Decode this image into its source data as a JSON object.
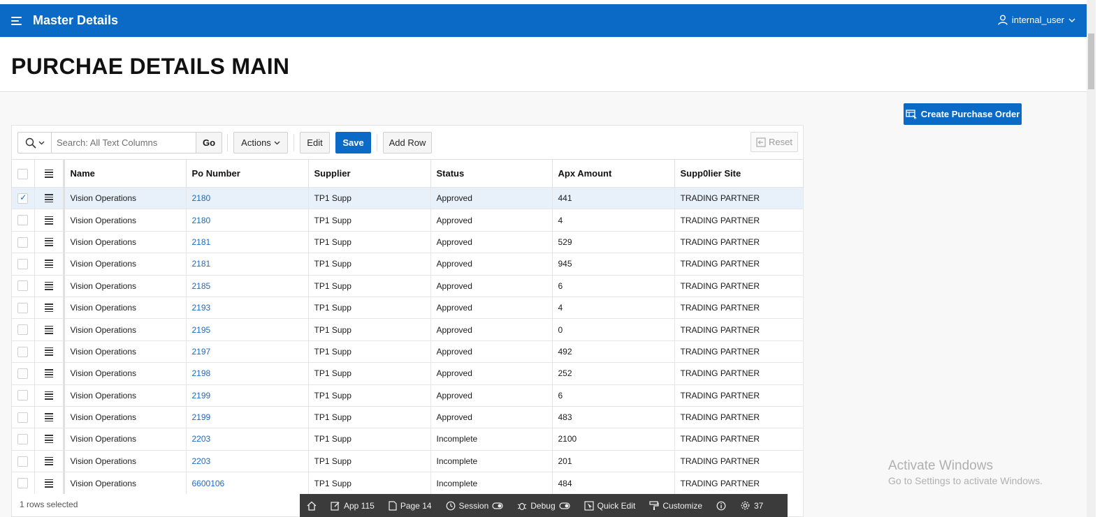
{
  "header": {
    "menu_icon": "hamburger-icon",
    "app_title": "Master Details",
    "user_name": "internal_user",
    "user_icon": "user-icon",
    "brand_color": "#0b6ac6"
  },
  "page": {
    "title": "PURCHAE DETAILS MAIN"
  },
  "actions": {
    "create_label": "Create Purchase Order"
  },
  "toolbar": {
    "search_placeholder": "Search: All Text Columns",
    "search_value": "",
    "go_label": "Go",
    "actions_label": "Actions",
    "edit_label": "Edit",
    "save_label": "Save",
    "add_row_label": "Add Row",
    "reset_label": "Reset"
  },
  "grid": {
    "columns": [
      "Name",
      "Po Number",
      "Supplier",
      "Status",
      "Apx Amount",
      "Supp0lier Site"
    ],
    "rows": [
      {
        "name": "Vision Operations",
        "po": "2180",
        "supplier": "TP1 Supp",
        "status": "Approved",
        "amount": "441",
        "site": "TRADING PARTNER",
        "selected": true
      },
      {
        "name": "Vision Operations",
        "po": "2180",
        "supplier": "TP1 Supp",
        "status": "Approved",
        "amount": "4",
        "site": "TRADING PARTNER",
        "selected": false
      },
      {
        "name": "Vision Operations",
        "po": "2181",
        "supplier": "TP1 Supp",
        "status": "Approved",
        "amount": "529",
        "site": "TRADING PARTNER",
        "selected": false
      },
      {
        "name": "Vision Operations",
        "po": "2181",
        "supplier": "TP1 Supp",
        "status": "Approved",
        "amount": "945",
        "site": "TRADING PARTNER",
        "selected": false
      },
      {
        "name": "Vision Operations",
        "po": "2185",
        "supplier": "TP1 Supp",
        "status": "Approved",
        "amount": "6",
        "site": "TRADING PARTNER",
        "selected": false
      },
      {
        "name": "Vision Operations",
        "po": "2193",
        "supplier": "TP1 Supp",
        "status": "Approved",
        "amount": "4",
        "site": "TRADING PARTNER",
        "selected": false
      },
      {
        "name": "Vision Operations",
        "po": "2195",
        "supplier": "TP1 Supp",
        "status": "Approved",
        "amount": "0",
        "site": "TRADING PARTNER",
        "selected": false
      },
      {
        "name": "Vision Operations",
        "po": "2197",
        "supplier": "TP1 Supp",
        "status": "Approved",
        "amount": "492",
        "site": "TRADING PARTNER",
        "selected": false
      },
      {
        "name": "Vision Operations",
        "po": "2198",
        "supplier": "TP1 Supp",
        "status": "Approved",
        "amount": "252",
        "site": "TRADING PARTNER",
        "selected": false
      },
      {
        "name": "Vision Operations",
        "po": "2199",
        "supplier": "TP1 Supp",
        "status": "Approved",
        "amount": "6",
        "site": "TRADING PARTNER",
        "selected": false
      },
      {
        "name": "Vision Operations",
        "po": "2199",
        "supplier": "TP1 Supp",
        "status": "Approved",
        "amount": "483",
        "site": "TRADING PARTNER",
        "selected": false
      },
      {
        "name": "Vision Operations",
        "po": "2203",
        "supplier": "TP1 Supp",
        "status": "Incomplete",
        "amount": "2100",
        "site": "TRADING PARTNER",
        "selected": false
      },
      {
        "name": "Vision Operations",
        "po": "2203",
        "supplier": "TP1 Supp",
        "status": "Incomplete",
        "amount": "201",
        "site": "TRADING PARTNER",
        "selected": false
      },
      {
        "name": "Vision Operations",
        "po": "6600106",
        "supplier": "TP1 Supp",
        "status": "Incomplete",
        "amount": "484",
        "site": "TRADING PARTNER",
        "selected": false
      }
    ],
    "footer_status": "1 rows selected"
  },
  "dev_toolbar": {
    "items": [
      {
        "icon": "home-icon",
        "label": ""
      },
      {
        "icon": "edit-icon",
        "label": "App 115"
      },
      {
        "icon": "page-icon",
        "label": "Page 14"
      },
      {
        "icon": "clock-icon",
        "label": "Session"
      },
      {
        "icon": "bug-icon",
        "label": "Debug"
      },
      {
        "icon": "quick-edit-icon",
        "label": "Quick Edit"
      },
      {
        "icon": "paint-roller-icon",
        "label": "Customize"
      },
      {
        "icon": "info-icon",
        "label": ""
      },
      {
        "icon": "gear-icon",
        "label": ""
      }
    ],
    "trailing_text": "37"
  },
  "watermark": {
    "line1": "Activate Windows",
    "line2": "Go to Settings to activate Windows."
  }
}
